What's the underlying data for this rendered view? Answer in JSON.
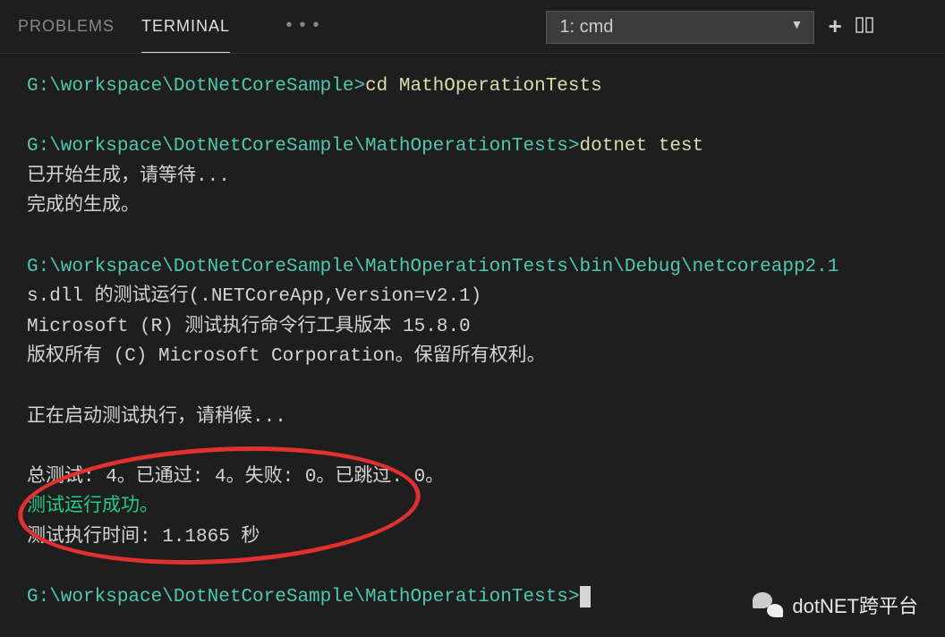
{
  "panel": {
    "tabs": {
      "problems": "PROBLEMS",
      "terminal": "TERMINAL"
    },
    "dropdown": {
      "selected": "1: cmd"
    }
  },
  "terminal": {
    "line1_path": "G:\\workspace\\DotNetCoreSample>",
    "line1_cmd": "cd MathOperationTests",
    "line2_path": "G:\\workspace\\DotNetCoreSample\\MathOperationTests>",
    "line2_cmd": "dotnet test",
    "line3": "已开始生成，请等待...",
    "line4": "完成的生成。",
    "line5_path": "G:\\workspace\\DotNetCoreSample\\MathOperationTests\\bin\\Debug\\netcoreapp2.1",
    "line6": "s.dll 的测试运行(.NETCoreApp,Version=v2.1)",
    "line7": "Microsoft (R) 测试执行命令行工具版本 15.8.0",
    "line8": "版权所有 (C) Microsoft Corporation。保留所有权利。",
    "line9": "正在启动测试执行，请稍候...",
    "line10": "总测试: 4。已通过: 4。失败: 0。已跳过: 0。",
    "line11": "测试运行成功。",
    "line12": "测试执行时间: 1.1865 秒",
    "line13_path": "G:\\workspace\\DotNetCoreSample\\MathOperationTests>"
  },
  "watermark": {
    "text": "dotNET跨平台"
  }
}
